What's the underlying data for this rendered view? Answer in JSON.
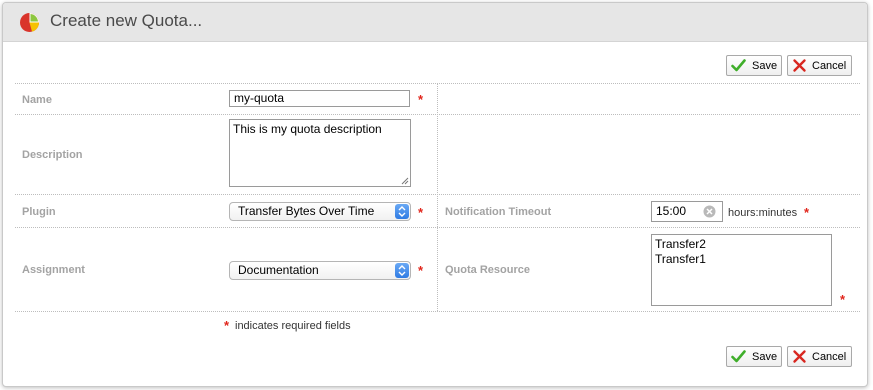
{
  "dialog": {
    "title": "Create new Quota...",
    "icon": "pie-chart-icon"
  },
  "toolbar": {
    "save_label": "Save",
    "cancel_label": "Cancel"
  },
  "form": {
    "name": {
      "label": "Name",
      "value": "my-quota",
      "required": true
    },
    "description": {
      "label": "Description",
      "value": "This is my quota description"
    },
    "plugin": {
      "label": "Plugin",
      "value": "Transfer Bytes Over Time",
      "required": true
    },
    "notification_timeout": {
      "label": "Notification Timeout",
      "value": "15:00",
      "unit": "hours:minutes",
      "required": true
    },
    "assignment": {
      "label": "Assignment",
      "value": "Documentation",
      "required": true
    },
    "quota_resource": {
      "label": "Quota Resource",
      "options": [
        "Transfer2",
        "Transfer1"
      ],
      "required": true
    }
  },
  "footer": {
    "required_marker": "*",
    "required_note": "indicates required fields"
  },
  "colors": {
    "required": "#e1251b",
    "label": "#a3a3a3",
    "titlebar": "#e6e6e6",
    "select_arrow": "#2f7be3"
  }
}
